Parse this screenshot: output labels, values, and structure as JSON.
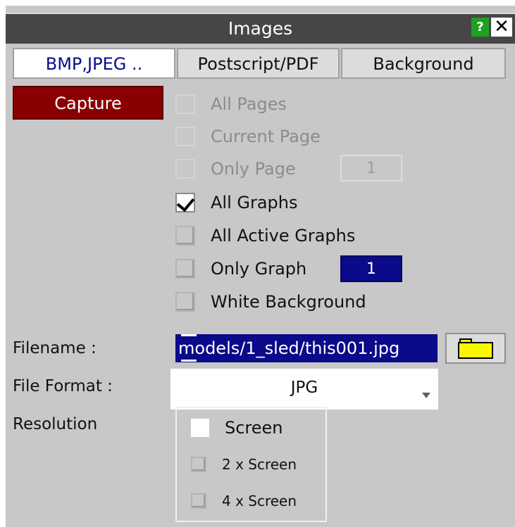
{
  "window": {
    "title": "Images",
    "help_label": "?",
    "close_label": "✕"
  },
  "tabs": [
    {
      "label": "BMP,JPEG ..",
      "active": true
    },
    {
      "label": "Postscript/PDF",
      "active": false
    },
    {
      "label": "Background",
      "active": false
    }
  ],
  "capture": {
    "label": "Capture"
  },
  "options": {
    "all_pages": {
      "label": "All Pages",
      "checked": false,
      "enabled": false
    },
    "current_page": {
      "label": "Current Page",
      "checked": false,
      "enabled": false
    },
    "only_page": {
      "label": "Only Page",
      "checked": false,
      "enabled": false,
      "value": "1"
    },
    "all_graphs": {
      "label": "All Graphs",
      "checked": true,
      "enabled": true
    },
    "all_active_graphs": {
      "label": "All Active Graphs",
      "checked": false,
      "enabled": true
    },
    "only_graph": {
      "label": "Only Graph",
      "checked": false,
      "enabled": true,
      "value": "1"
    },
    "white_background": {
      "label": "White Background",
      "checked": false,
      "enabled": true
    }
  },
  "filename": {
    "label": "Filename :",
    "value": "models/1_sled/this001.jpg",
    "browse_icon": "folder-icon"
  },
  "file_format": {
    "label": "File Format :",
    "value": "JPG"
  },
  "resolution": {
    "label": "Resolution",
    "options": [
      {
        "label": "Screen",
        "selected": true
      },
      {
        "label": "2 x Screen",
        "selected": false
      },
      {
        "label": "4 x Screen",
        "selected": false
      }
    ]
  },
  "colors": {
    "titlebar": "#464646",
    "capture_button": "#8a0000",
    "highlight": "#0a0a8a",
    "panel": "#c8c8c8",
    "folder": "#f8f800"
  }
}
